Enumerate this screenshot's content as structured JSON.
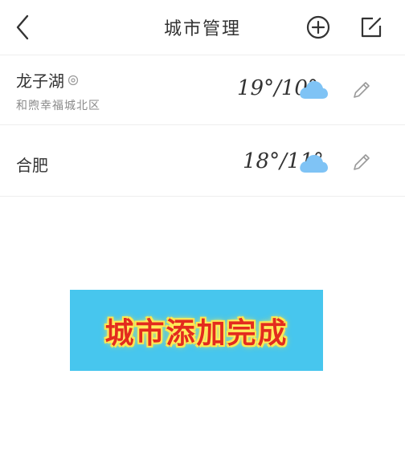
{
  "header": {
    "title": "城市管理",
    "back_icon": "chevron-left-icon",
    "add_icon": "plus-circle-icon",
    "edit_icon": "edit-square-icon"
  },
  "cities": [
    {
      "name": "龙子湖",
      "sub": "和煦幸福城北区",
      "temp": "19°/10°",
      "weather_icon": "cloud-icon",
      "has_location": true
    },
    {
      "name": "合肥",
      "sub": "",
      "temp": "18°/11°",
      "weather_icon": "cloud-icon",
      "has_location": false
    }
  ],
  "banner": {
    "text": "城市添加完成",
    "bg_color": "#47c6ee",
    "text_color": "#e32c1e"
  },
  "colors": {
    "cloud": "#7fc3f5",
    "icon": "#333333"
  }
}
